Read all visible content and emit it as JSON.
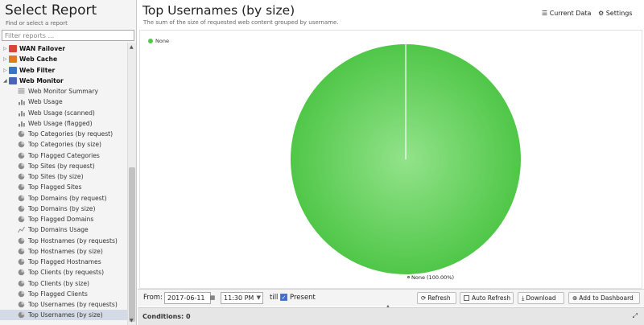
{
  "sidebar": {
    "title": "Select Report",
    "subtitle": "Find or select a report",
    "filter_placeholder": "Filter reports ...",
    "categories": [
      {
        "label": "WAN Failover",
        "color": "#d8463b"
      },
      {
        "label": "Web Cache",
        "color": "#e07a1f"
      },
      {
        "label": "Web Filter",
        "color": "#3a72c4"
      },
      {
        "label": "Web Monitor",
        "color": "#4a63b6"
      }
    ],
    "items": [
      {
        "label": "Web Monitor Summary",
        "icon": "text-report-icon"
      },
      {
        "label": "Web Usage",
        "icon": "bar-chart-icon"
      },
      {
        "label": "Web Usage (scanned)",
        "icon": "bar-chart-icon"
      },
      {
        "label": "Web Usage (flagged)",
        "icon": "bar-chart-icon"
      },
      {
        "label": "Top Categories (by request)",
        "icon": "pie-chart-icon"
      },
      {
        "label": "Top Categories (by size)",
        "icon": "pie-chart-icon"
      },
      {
        "label": "Top Flagged Categories",
        "icon": "pie-chart-icon"
      },
      {
        "label": "Top Sites (by request)",
        "icon": "pie-chart-icon"
      },
      {
        "label": "Top Sites (by size)",
        "icon": "pie-chart-icon"
      },
      {
        "label": "Top Flagged Sites",
        "icon": "pie-chart-icon"
      },
      {
        "label": "Top Domains (by request)",
        "icon": "pie-chart-icon"
      },
      {
        "label": "Top Domains (by size)",
        "icon": "pie-chart-icon"
      },
      {
        "label": "Top Flagged Domains",
        "icon": "pie-chart-icon"
      },
      {
        "label": "Top Domains Usage",
        "icon": "line-chart-icon"
      },
      {
        "label": "Top Hostnames (by requests)",
        "icon": "pie-chart-icon"
      },
      {
        "label": "Top Hostnames (by size)",
        "icon": "pie-chart-icon"
      },
      {
        "label": "Top Flagged Hostnames",
        "icon": "pie-chart-icon"
      },
      {
        "label": "Top Clients (by requests)",
        "icon": "pie-chart-icon"
      },
      {
        "label": "Top Clients (by size)",
        "icon": "pie-chart-icon"
      },
      {
        "label": "Top Flagged Clients",
        "icon": "pie-chart-icon"
      },
      {
        "label": "Top Usernames (by requests)",
        "icon": "pie-chart-icon"
      },
      {
        "label": "Top Usernames (by size)",
        "icon": "pie-chart-icon"
      }
    ],
    "selected_index": 21
  },
  "report": {
    "title": "Top Usernames (by size)",
    "description": "The sum of the size of requested web content grouped by username.",
    "current_data_label": "Current Data",
    "settings_label": "Settings"
  },
  "chart_data": {
    "type": "pie",
    "categories": [
      "None"
    ],
    "values": [
      100
    ],
    "slice_labels": [
      "None (100.00%)"
    ],
    "legend": {
      "entries": [
        "None"
      ],
      "placement": "top-left"
    },
    "colors": [
      "#52c84a"
    ]
  },
  "toolbar": {
    "from_label": "From:",
    "date_value": "2017-06-11",
    "time_value": "11:30 PM",
    "till_label": "till",
    "present_label": "Present",
    "present_checked": true,
    "refresh_label": "Refresh",
    "auto_refresh_label": "Auto Refresh",
    "download_label": "Download",
    "dashboard_label": "Add to Dashboard"
  },
  "conditions": {
    "label": "Conditions: 0"
  }
}
